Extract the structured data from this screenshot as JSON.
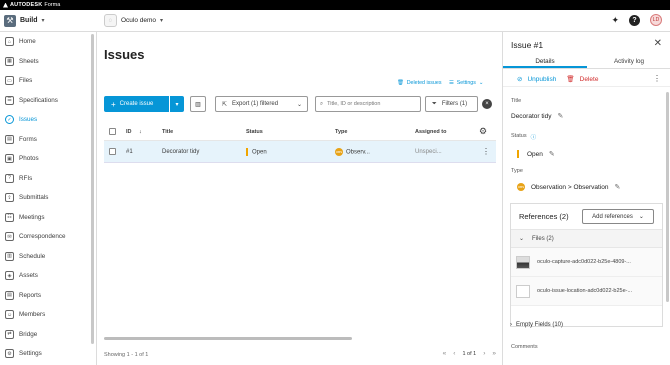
{
  "topbar": {
    "brand": "AUTODESK",
    "product": "Forma"
  },
  "appbar": {
    "app_name": "Build",
    "project_name": "Oculo demo",
    "avatar_initials": "LD"
  },
  "sidebar": {
    "items": [
      {
        "label": "Home",
        "icon": "home-icon"
      },
      {
        "label": "Sheets",
        "icon": "sheets-icon"
      },
      {
        "label": "Files",
        "icon": "folder-icon"
      },
      {
        "label": "Specifications",
        "icon": "specifications-icon"
      },
      {
        "label": "Issues",
        "icon": "issues-icon",
        "active": true
      },
      {
        "label": "Forms",
        "icon": "forms-icon"
      },
      {
        "label": "Photos",
        "icon": "photos-icon"
      },
      {
        "label": "RFIs",
        "icon": "rfis-icon"
      },
      {
        "label": "Submittals",
        "icon": "submittals-icon"
      },
      {
        "label": "Meetings",
        "icon": "meetings-icon"
      },
      {
        "label": "Correspondence",
        "icon": "correspondence-icon"
      },
      {
        "label": "Schedule",
        "icon": "schedule-icon"
      },
      {
        "label": "Assets",
        "icon": "assets-icon"
      },
      {
        "label": "Reports",
        "icon": "reports-icon"
      },
      {
        "label": "Members",
        "icon": "members-icon"
      },
      {
        "label": "Bridge",
        "icon": "bridge-icon"
      },
      {
        "label": "Settings",
        "icon": "settings-icon"
      }
    ]
  },
  "main": {
    "title": "Issues",
    "deleted_issues": "Deleted issues",
    "settings": "Settings",
    "create_issue": "Create issue",
    "export": "Export (1) filtered",
    "search_placeholder": "Title, ID or description",
    "filters": "Filters (1)",
    "columns": {
      "id": "ID",
      "title": "Title",
      "status": "Status",
      "type": "Type",
      "assigned": "Assigned to"
    },
    "rows": [
      {
        "id": "#1",
        "title": "Decorator tidy",
        "status": "Open",
        "type": "Observ...",
        "assigned": "Unspeci..."
      }
    ],
    "footer": "Showing 1 - 1 of 1",
    "page": "1 of 1"
  },
  "panel": {
    "title": "Issue #1",
    "tab_details": "Details",
    "tab_activity": "Activity log",
    "unpublish": "Unpublish",
    "delete": "Delete",
    "title_label": "Title",
    "title_value": "Decorator tidy",
    "status_label": "Status",
    "status_value": "Open",
    "type_label": "Type",
    "type_value": "Observation > Observation",
    "references": "References (2)",
    "add_references": "Add references",
    "files_label": "Files (2)",
    "files": [
      {
        "name": "oculo-capture-adc0d022-b25e-4809-..."
      },
      {
        "name": "oculo-issue-location-adc0d022-b25e-..."
      }
    ],
    "empty_fields": "Empty Fields (10)",
    "comments": "Comments"
  },
  "colors": {
    "accent": "#0696d7",
    "open_status": "#f0a500",
    "delete": "#d12c2c",
    "observation": "#e8a317"
  }
}
